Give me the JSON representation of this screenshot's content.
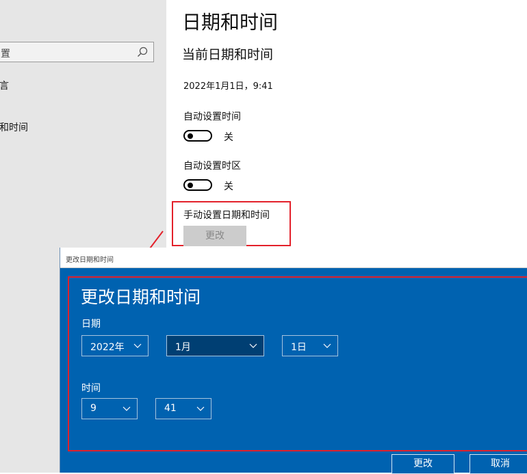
{
  "sidebar": {
    "search_partial": "置",
    "item_partial_1": "言",
    "item_partial_2": "和时间"
  },
  "main": {
    "title": "日期和时间",
    "section_title": "当前日期和时间",
    "current_datetime": "2022年1月1日，9:41",
    "auto_time": {
      "label": "自动设置时间",
      "state": "关"
    },
    "auto_zone": {
      "label": "自动设置时区",
      "state": "关"
    },
    "manual": {
      "label": "手动设置日期和时间",
      "button": "更改"
    }
  },
  "dialog": {
    "window_title": "更改日期和时间",
    "heading": "更改日期和时间",
    "date_label": "日期",
    "year": "2022年",
    "month": "1月",
    "day": "1日",
    "time_label": "时间",
    "hour": "9",
    "minute": "41",
    "change_button": "更改",
    "cancel_button": "取消"
  },
  "colors": {
    "accent": "#0062b0",
    "highlight": "#e3202a",
    "sidebar_bg": "#e6e6e6"
  }
}
